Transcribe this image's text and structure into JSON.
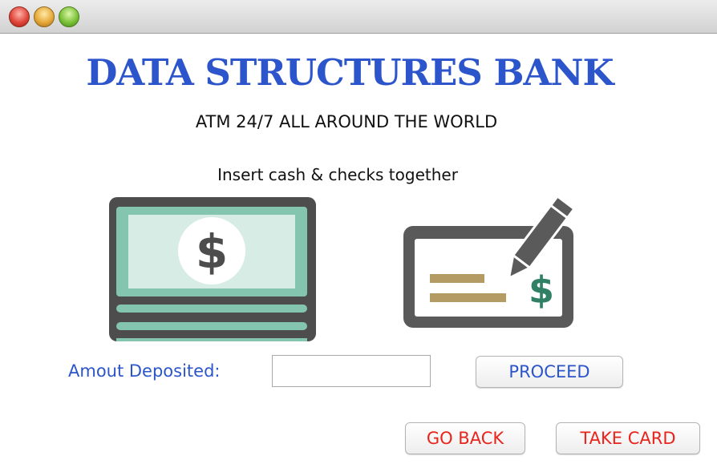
{
  "window": {
    "buttons": [
      "close",
      "minimize",
      "zoom"
    ]
  },
  "header": {
    "title": "DATA STRUCTURES BANK",
    "subtitle": "ATM 24/7 ALL AROUND THE WORLD"
  },
  "deposit": {
    "instruction": "Insert cash & checks together",
    "cash_icon": "cash-stack-icon",
    "check_icon": "check-with-pen-icon",
    "dollar_sign": "$",
    "amount_label": "Amout Deposited:",
    "amount_value": "",
    "proceed_label": "PROCEED"
  },
  "footer": {
    "go_back_label": "GO BACK",
    "take_card_label": "TAKE CARD"
  },
  "colors": {
    "title_blue": "#2c55cc",
    "action_red": "#e8241c",
    "cash_green": "#84c5b0",
    "icon_dark": "#4d4d4d",
    "check_gold": "#b49b63",
    "dollar_green": "#2f8064"
  }
}
